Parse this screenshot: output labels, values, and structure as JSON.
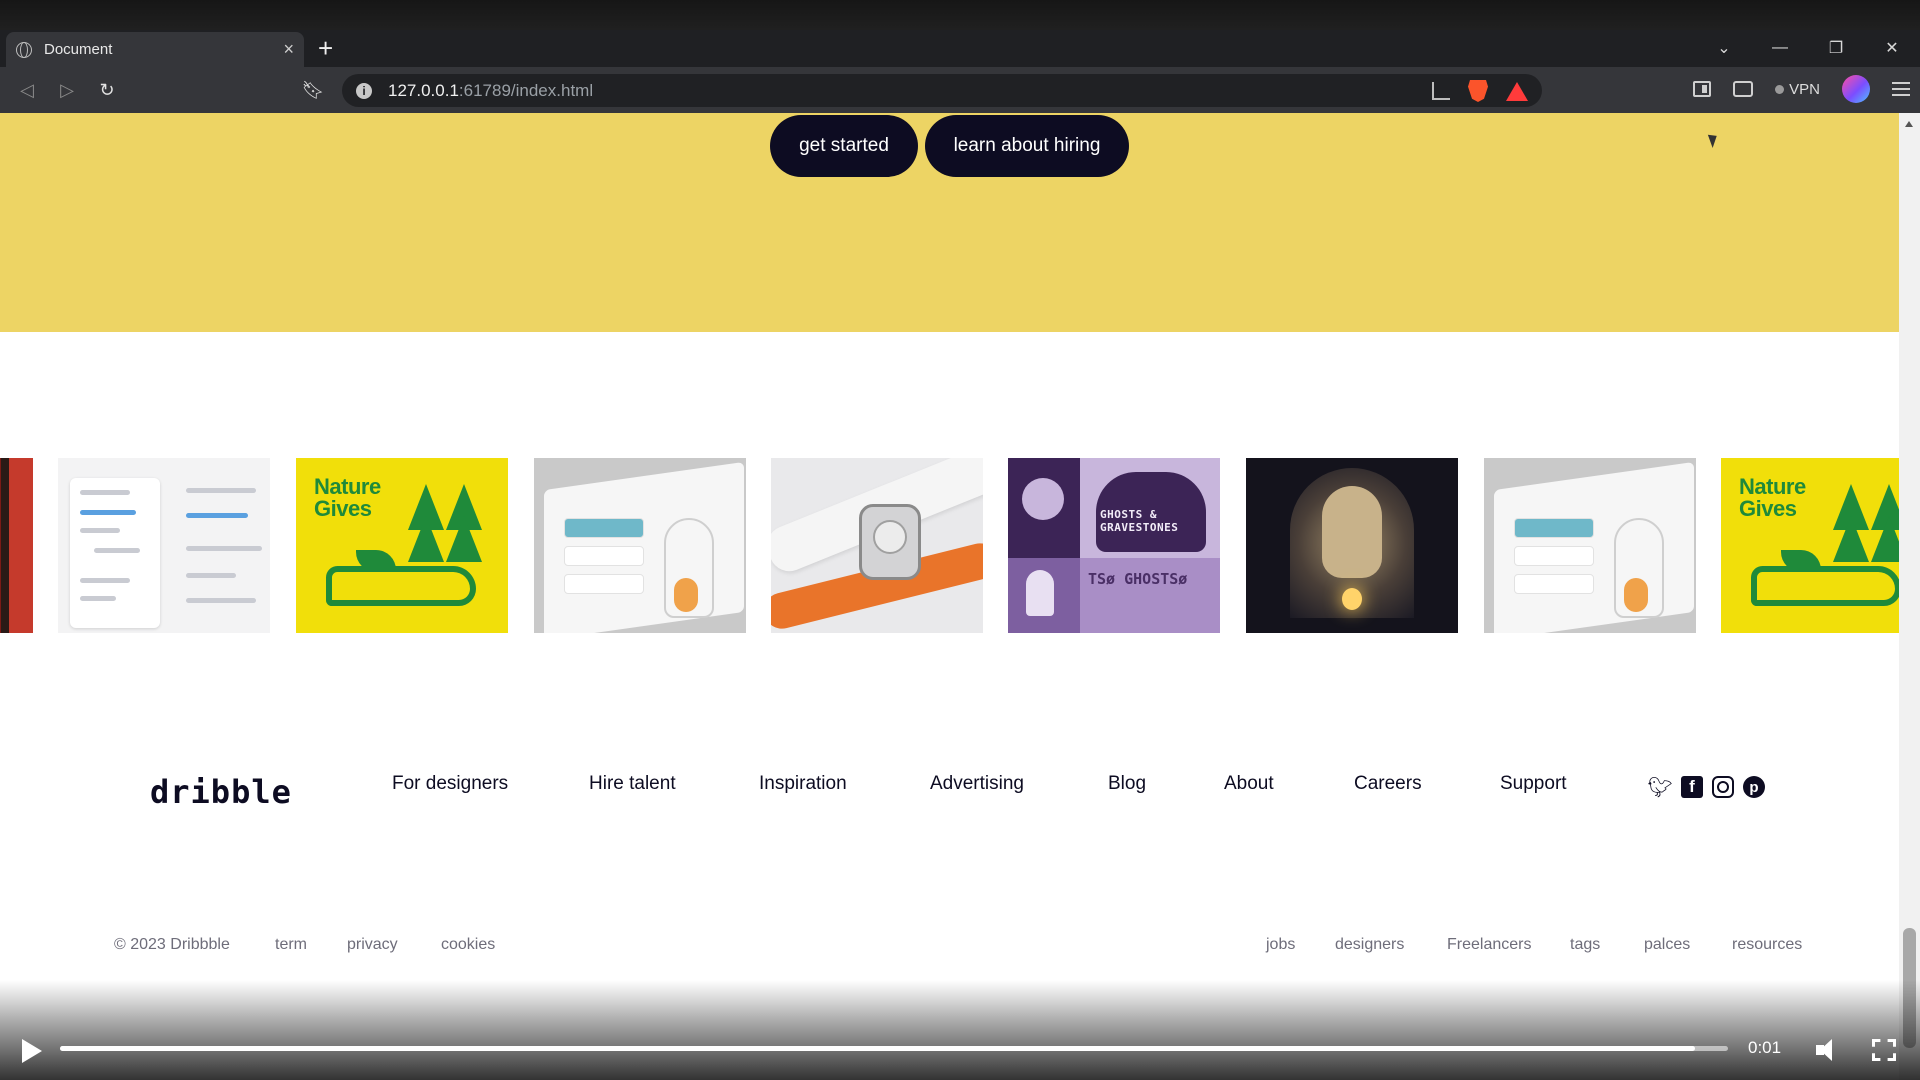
{
  "browser": {
    "tab_title": "Document",
    "tab_close": "×",
    "new_tab": "+",
    "url_host": "127.0.0.1",
    "url_rest": ":61789/index.html",
    "vpn_label": "VPN",
    "window_controls": [
      "⌄",
      "—",
      "❐",
      "✕"
    ]
  },
  "hero": {
    "bg_color": "#edd464",
    "primary_button": "get started",
    "secondary_button": "learn about hiring"
  },
  "shots": [
    {
      "name": "red-stripes-shot"
    },
    {
      "name": "dashboard-shot"
    },
    {
      "name": "nature-gives-shot",
      "text": "Nature Gives"
    },
    {
      "name": "laptop-anatomy-shot"
    },
    {
      "name": "watch-shot"
    },
    {
      "name": "ghosts-gravestones-shot",
      "text": "GHOSTS & GRAVESTONES",
      "strip": "TSø GHOSTSø"
    },
    {
      "name": "cave-creature-shot"
    },
    {
      "name": "laptop-anatomy-shot"
    },
    {
      "name": "nature-gives-shot",
      "text": "Nature Gives"
    }
  ],
  "footer": {
    "logo": "dribble",
    "nav": [
      "For designers",
      "Hire talent",
      "Inspiration",
      "Advertising",
      "Blog",
      "About",
      "Careers",
      "Support"
    ],
    "social_icons": [
      "twitter-icon",
      "facebook-icon",
      "instagram-icon",
      "pinterest-icon"
    ],
    "copyright": "© 2023 Dribbble",
    "legal_links": [
      "term",
      "privacy",
      "cookies"
    ],
    "right_links": [
      "jobs",
      "designers",
      "Freelancers",
      "tags",
      "palces",
      "resources"
    ]
  },
  "video": {
    "time": "0:01",
    "progress": 0.98
  }
}
